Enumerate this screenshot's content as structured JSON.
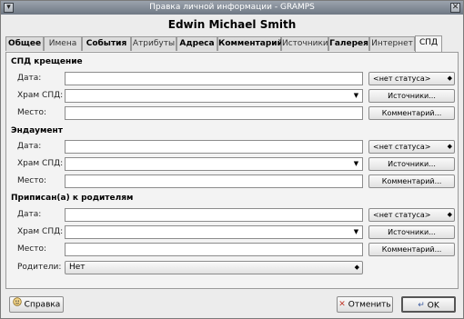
{
  "window": {
    "title": "Правка личной информации - GRAMPS"
  },
  "person_name": "Edwin Michael Smith",
  "tabs": [
    {
      "label": "Общее"
    },
    {
      "label": "Имена"
    },
    {
      "label": "События"
    },
    {
      "label": "Атрибуты"
    },
    {
      "label": "Адреса"
    },
    {
      "label": "Комментарий"
    },
    {
      "label": "Источники"
    },
    {
      "label": "Галерея"
    },
    {
      "label": "Интернет"
    },
    {
      "label": "СПД"
    }
  ],
  "sections": [
    {
      "title": "СПД крещение",
      "date_label": "Дата:",
      "temple_label": "Храм СПД:",
      "place_label": "Место:",
      "date_value": "",
      "temple_value": "",
      "place_value": "",
      "status": "<нет статуса>",
      "sources_button": "Источники...",
      "comment_button": "Комментарий..."
    },
    {
      "title": "Эндаумент",
      "date_label": "Дата:",
      "temple_label": "Храм СПД:",
      "place_label": "Место:",
      "date_value": "",
      "temple_value": "",
      "place_value": "",
      "status": "<нет статуса>",
      "sources_button": "Источники...",
      "comment_button": "Комментарий..."
    },
    {
      "title": "Приписан(а) к родителям",
      "date_label": "Дата:",
      "temple_label": "Храм СПД:",
      "place_label": "Место:",
      "date_value": "",
      "temple_value": "",
      "place_value": "",
      "status": "<нет статуса>",
      "sources_button": "Источники...",
      "comment_button": "Комментарий...",
      "parents_label": "Родители:",
      "parents_value": "Нет"
    }
  ],
  "footer": {
    "help_button": "Справка",
    "cancel_button": "Отменить",
    "ok_button": "OK"
  }
}
